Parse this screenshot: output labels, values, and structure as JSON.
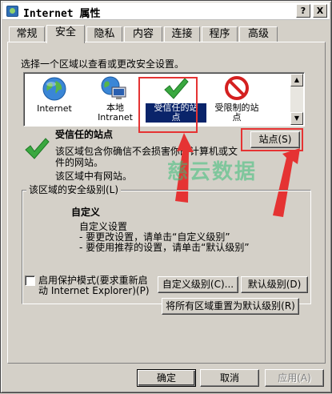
{
  "window": {
    "title": "Internet 属性",
    "help_label": "?",
    "close_label": "X"
  },
  "tabs": [
    "常规",
    "安全",
    "隐私",
    "内容",
    "连接",
    "程序",
    "高级"
  ],
  "active_tab": "安全",
  "security": {
    "select_zone_prompt": "选择一个区域以查看或更改安全设置。",
    "zones": [
      {
        "label_lines": [
          "Internet"
        ],
        "icon": "globe-icon"
      },
      {
        "label_lines": [
          "本地",
          "Intranet"
        ],
        "icon": "intranet-icon"
      },
      {
        "label_lines": [
          "受信任的站",
          "点"
        ],
        "icon": "checkmark-icon",
        "selected": true
      },
      {
        "label_lines": [
          "受限制的站",
          "点"
        ],
        "icon": "restricted-icon"
      }
    ],
    "zone_title": "受信任的站点",
    "zone_description_lines": [
      "该区域包含你确信不会损害你的计算机或文",
      "件的网站。"
    ],
    "zone_has_sites": "该区域中有网站。",
    "sites_button": "站点(S)",
    "level_group_label": "该区域的安全级别(L)",
    "level_name": "自定义",
    "level_description_lines": [
      "自定义设置",
      "- 要更改设置，请单击“自定义级别”",
      "- 要使用推荐的设置，请单击“默认级别”"
    ],
    "protected_mode_lines": [
      "启用保护模式(要求重新启",
      "动 Internet Explorer)(P)"
    ],
    "protected_mode_checked": false,
    "custom_level_button": "自定义级别(C)...",
    "default_level_button": "默认级别(D)",
    "reset_all_button": "将所有区域重置为默认级别(R)"
  },
  "footer": {
    "ok_button": "确定",
    "cancel_button": "取消",
    "apply_button": "应用(A)"
  },
  "watermark": "慈云数据",
  "colors": {
    "selection": "#0a246a",
    "annotation": "#e53333",
    "dialog_bg": "#d4d0c8"
  }
}
